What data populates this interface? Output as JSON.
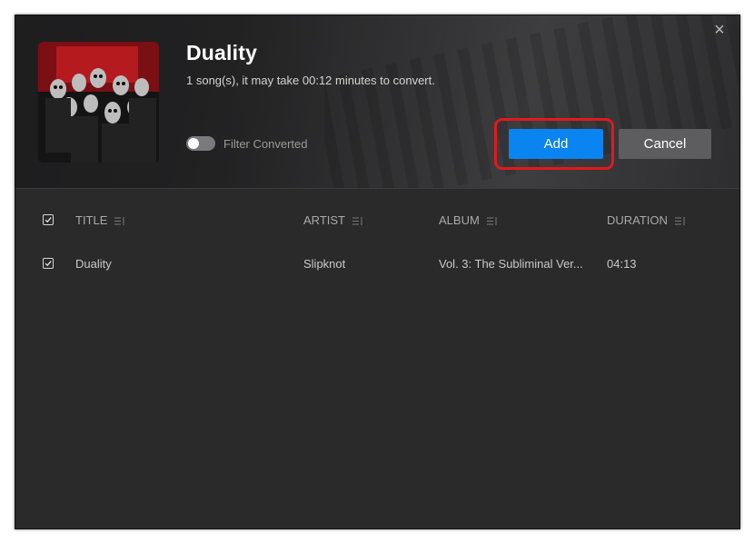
{
  "dialog": {
    "title": "Duality",
    "subtitle": "1 song(s), it may take 00:12 minutes to convert.",
    "close_icon": "×",
    "filter": {
      "label": "Filter Converted",
      "enabled": false
    },
    "buttons": {
      "add": "Add",
      "cancel": "Cancel"
    },
    "accent_color": "#0a84f0",
    "highlight_color": "#e0191e"
  },
  "table": {
    "headers": {
      "title": "TITLE",
      "artist": "ARTIST",
      "album": "ALBUM",
      "duration": "DURATION"
    },
    "rows": [
      {
        "checked": true,
        "title": "Duality",
        "artist": "Slipknot",
        "album": "Vol. 3: The Subliminal Ver...",
        "duration": "04:13"
      }
    ]
  }
}
